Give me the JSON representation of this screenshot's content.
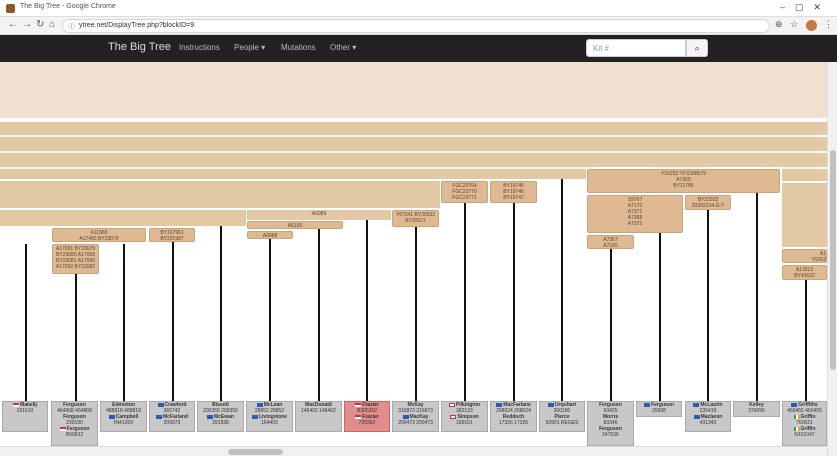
{
  "browser": {
    "tab_title": "The Big Tree - Google Chrome",
    "url": "ytree.net/DisplayTree.php?blockID=9"
  },
  "site": {
    "brand": "The Big Tree",
    "nav": [
      "Instructions",
      "People ▾",
      "Mutations",
      "Other ▾"
    ],
    "search_placeholder": "Kit #"
  },
  "blocks": [
    {
      "text": "A11965\nA17465 BY23079"
    },
    {
      "text": "A17091 BY23079\nBY23080 A17093\nBY23081 A17090\nA17092 BY23082"
    },
    {
      "text": "BY167961\nBY201987"
    },
    {
      "text": "A6089"
    },
    {
      "text": "A6100"
    },
    {
      "text": "A6088"
    },
    {
      "text": "Y67341 BY20532\nBY20527"
    },
    {
      "text": "FGC23764\nFGC23770\nFGC23771"
    },
    {
      "text": "BY19745\nBY19746\nBY19747"
    },
    {
      "text": "Y16252 YFS398679\nA7369\nBY11786"
    },
    {
      "text": "S9767\nA7170\nA7371\nA7368\nA7372"
    },
    {
      "text": "BY23333\n20302234-G-T"
    },
    {
      "text": "A7367\nA7165"
    },
    {
      "text": "A1\nY9262"
    },
    {
      "text": "A13013\nBY43622"
    }
  ],
  "leaves": [
    {
      "flag": "us",
      "name": "Makelij",
      "id": "191610"
    },
    {
      "flag": "",
      "name": "Ferguson",
      "id": "464868 464868",
      "name2": "Ferguson",
      "id2": "230190",
      "flag3": "us",
      "name3": "Ferguson",
      "id3": "B59632"
    },
    {
      "flag": "",
      "name": "Edmiston",
      "id": "488818 488818",
      "flag2": "sco",
      "name2": "Campbell",
      "id2": "IN41269"
    },
    {
      "flag": "sco",
      "name": "Crawford",
      "id": "365742",
      "flag2": "sco",
      "name2": "McFarland",
      "id2": "209973"
    },
    {
      "flag": "",
      "name": "Bissett",
      "id": "200355 200355",
      "flag2": "sco",
      "name2": "McEwan",
      "id2": "391938"
    },
    {
      "flag": "sco",
      "name": "McLean",
      "id": "28852 28852",
      "flag2": "sco",
      "name2": "Livingstone",
      "id2": "164403"
    },
    {
      "flag": "",
      "name": "MacDonald",
      "id": "146402 146402"
    },
    {
      "flag": "us",
      "name": "Frazier",
      "id": "B305352",
      "flag2": "us",
      "name2": "Frazier",
      "id2": "720362",
      "red": true
    },
    {
      "flag": "",
      "name": "McKay",
      "id": "316873 316873",
      "flag2": "sco",
      "name2": "MacKay",
      "id2": "200473 200473"
    },
    {
      "flag": "eng",
      "name": "Pilkington",
      "id": "382133",
      "flag2": "eng",
      "name2": "Simpson",
      "id2": "189101"
    },
    {
      "flag": "sco",
      "name": "MacFarlane",
      "id": "268024 268024",
      "name2": "Reddoch",
      "id2": "17326 17326"
    },
    {
      "flag": "sco",
      "name": "Urquhart",
      "id": "300190",
      "name2": "Pierce",
      "id2": "92901 REGES"
    },
    {
      "flag": "",
      "name": "Ferguson",
      "id": "50425",
      "name2": "Morris",
      "id2": "83346",
      "name3": "Ferguson",
      "id3": "247536"
    },
    {
      "flag": "sco",
      "name": "Ferguson",
      "id": "25938"
    },
    {
      "flag": "sco",
      "name": "McLaurin",
      "id": "235419",
      "flag2": "sco",
      "name2": "Maclaren",
      "id2": "431343"
    },
    {
      "flag": "",
      "name": "Kelley",
      "id": "379096"
    },
    {
      "flag": "sco",
      "name": "Griffiths",
      "id": "460455 460455",
      "flag2": "irl",
      "name2": "Griffin",
      "id2": "760621",
      "flag3": "irl",
      "name3": "Griffin",
      "id3": "N101047"
    }
  ]
}
